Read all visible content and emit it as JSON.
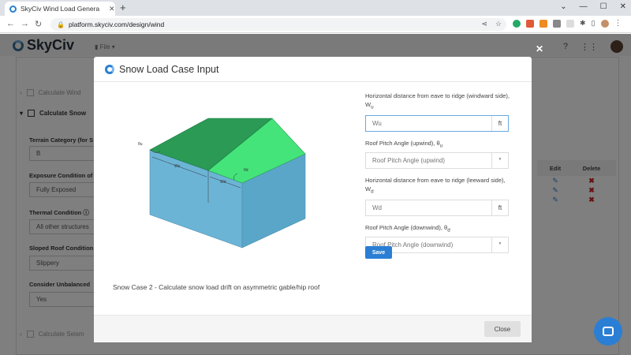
{
  "browser": {
    "tab_title": "SkyCiv Wind Load Genera",
    "url": "platform.skyciv.com/design/wind"
  },
  "app": {
    "logo_text": "SkyCiv",
    "file_menu": "File",
    "help_icon": "help-icon",
    "apps_icon": "grid-icon"
  },
  "background": {
    "row_calc_wind": "Calculate Wind",
    "row_calc_snow": "Calculate Snow",
    "row_calc_seismic": "Calculate Seism",
    "terrain_label": "Terrain Category (for S",
    "terrain_value": "B",
    "exposure_label": "Exposure Condition of",
    "exposure_value": "Fully Exposed",
    "thermal_label": "Thermal Condition",
    "thermal_value": "All other structures",
    "sloped_label": "Sloped Roof Condition",
    "sloped_value": "Slippery",
    "unbalanced_label": "Consider Unbalanced",
    "unbalanced_value": "Yes",
    "table_edit": "Edit",
    "table_delete": "Delete"
  },
  "modal": {
    "title": "Snow Load Case Input",
    "caption": "Snow Case 2 - Calculate snow load drift on asymmetric gable/hip roof",
    "diagram": {
      "label_wu": "Wu",
      "label_wd": "Wd",
      "label_thu": "θu",
      "label_thd": "θd"
    },
    "fields": {
      "wu_label": "Horizontal distance from eave to ridge (windward side), W",
      "wu_sub": "u",
      "wu_placeholder": "Wu",
      "wu_unit": "ft",
      "thu_label": "Roof Pitch Angle (upwind), θ",
      "thu_sub": "u",
      "thu_placeholder": "Roof Pitch Angle (upwind)",
      "thu_unit": "°",
      "wd_label": "Horizontal distance from eave to ridge (leeward side), W",
      "wd_sub": "d",
      "wd_placeholder": "Wd",
      "wd_unit": "ft",
      "thd_label": "Roof Pitch Angle (downwind), θ",
      "thd_sub": "d",
      "thd_placeholder": "Roof Pitch Angle (downwind)",
      "thd_unit": "°"
    },
    "save_label": "Save",
    "close_label": "Close"
  },
  "colors": {
    "accent": "#2a7fd4",
    "roof_dark": "#2a9a55",
    "roof_light": "#44e47a",
    "wall_front": "#6cb4d6",
    "wall_side": "#5aa6c8"
  }
}
